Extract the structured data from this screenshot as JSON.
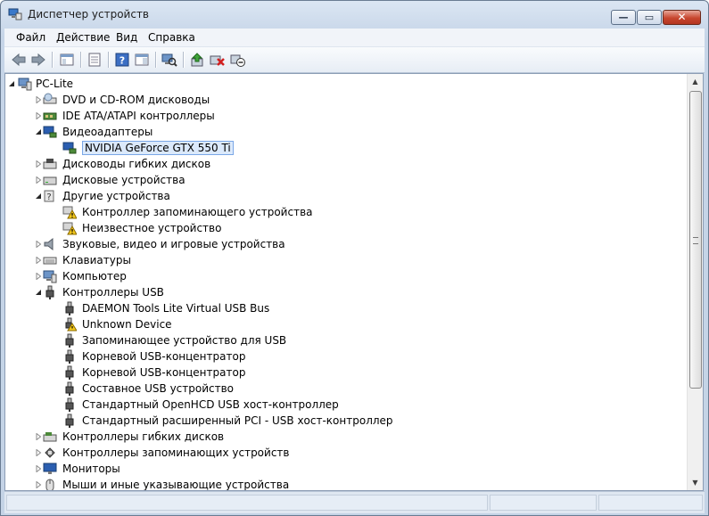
{
  "window": {
    "title": "Диспетчер устройств",
    "caption_buttons": [
      "minimize",
      "maximize",
      "close"
    ]
  },
  "menu": [
    {
      "label": "Файл"
    },
    {
      "label": "Действие"
    },
    {
      "label": "Вид"
    },
    {
      "label": "Справка"
    }
  ],
  "toolbar": [
    {
      "name": "back-arrow-icon"
    },
    {
      "name": "forward-arrow-icon"
    },
    {
      "name": "show-hide-console-tree-icon"
    },
    {
      "name": "properties-icon"
    },
    {
      "name": "help-icon"
    },
    {
      "name": "action-pane-icon"
    },
    {
      "name": "scan-hardware-icon"
    },
    {
      "name": "update-driver-icon"
    },
    {
      "name": "uninstall-icon"
    },
    {
      "name": "disable-device-icon"
    }
  ],
  "tree": [
    {
      "label": "PC-Lite",
      "level": 0,
      "expanded": true,
      "icon": "computer-icon"
    },
    {
      "label": "DVD и CD-ROM дисководы",
      "level": 1,
      "expanded": false,
      "icon": "dvd-drive-icon"
    },
    {
      "label": "IDE ATA/ATAPI контроллеры",
      "level": 1,
      "expanded": false,
      "icon": "ide-controller-icon"
    },
    {
      "label": "Видеоадаптеры",
      "level": 1,
      "expanded": true,
      "icon": "display-adapter-icon"
    },
    {
      "label": "NVIDIA GeForce GTX 550 Ti",
      "level": 2,
      "icon": "display-adapter-icon",
      "selected": true
    },
    {
      "label": "Дисководы гибких дисков",
      "level": 1,
      "expanded": false,
      "icon": "floppy-drive-icon"
    },
    {
      "label": "Дисковые устройства",
      "level": 1,
      "expanded": false,
      "icon": "disk-drive-icon"
    },
    {
      "label": "Другие устройства",
      "level": 1,
      "expanded": true,
      "icon": "other-devices-icon"
    },
    {
      "label": "Контроллер запоминающего устройства",
      "level": 2,
      "icon": "warning-device-icon"
    },
    {
      "label": "Неизвестное устройство",
      "level": 2,
      "icon": "warning-device-icon"
    },
    {
      "label": "Звуковые, видео и игровые устройства",
      "level": 1,
      "expanded": false,
      "icon": "speaker-icon"
    },
    {
      "label": "Клавиатуры",
      "level": 1,
      "expanded": false,
      "icon": "keyboard-icon"
    },
    {
      "label": "Компьютер",
      "level": 1,
      "expanded": false,
      "icon": "computer-icon"
    },
    {
      "label": "Контроллеры USB",
      "level": 1,
      "expanded": true,
      "icon": "usb-plug-icon"
    },
    {
      "label": "DAEMON Tools Lite Virtual USB Bus",
      "level": 2,
      "icon": "usb-plug-icon"
    },
    {
      "label": "Unknown Device",
      "level": 2,
      "icon": "usb-warning-icon"
    },
    {
      "label": "Запоминающее устройство для USB",
      "level": 2,
      "icon": "usb-plug-icon"
    },
    {
      "label": "Корневой USB-концентратор",
      "level": 2,
      "icon": "usb-plug-icon"
    },
    {
      "label": "Корневой USB-концентратор",
      "level": 2,
      "icon": "usb-plug-icon"
    },
    {
      "label": "Составное USB устройство",
      "level": 2,
      "icon": "usb-plug-icon"
    },
    {
      "label": "Стандартный OpenHCD USB хост-контроллер",
      "level": 2,
      "icon": "usb-plug-icon"
    },
    {
      "label": "Стандартный расширенный PCI - USB хост-контроллер",
      "level": 2,
      "icon": "usb-plug-icon"
    },
    {
      "label": "Контроллеры гибких дисков",
      "level": 1,
      "expanded": false,
      "icon": "floppy-controller-icon"
    },
    {
      "label": "Контроллеры запоминающих устройств",
      "level": 1,
      "expanded": false,
      "icon": "storage-controller-icon"
    },
    {
      "label": "Мониторы",
      "level": 1,
      "expanded": false,
      "icon": "monitor-icon"
    },
    {
      "label": "Мыши и иные указывающие устройства",
      "level": 1,
      "expanded": false,
      "icon": "mouse-icon"
    }
  ],
  "colors": {
    "selection_bg": "#dbe9fb",
    "selection_border": "#7aa7e6",
    "chrome": "#c4d3e6"
  }
}
